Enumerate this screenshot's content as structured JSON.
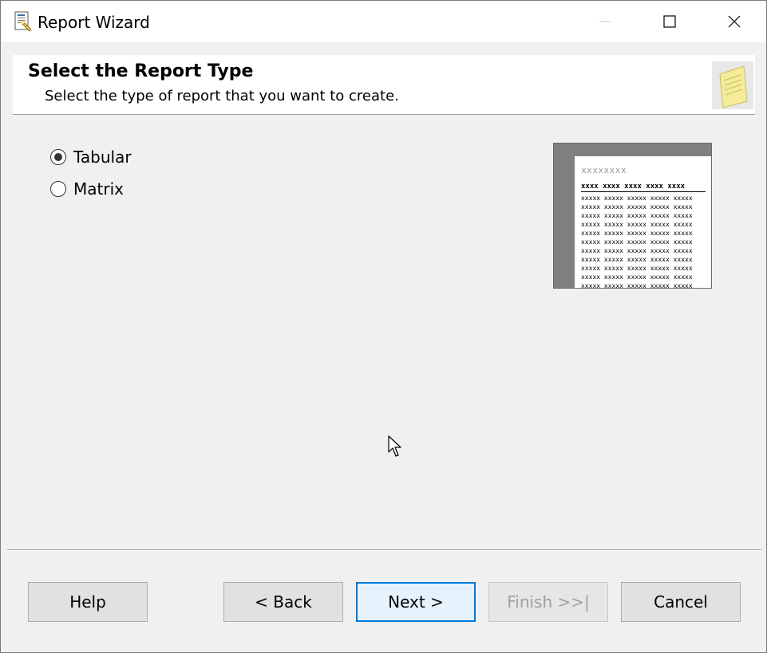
{
  "window": {
    "title": "Report Wizard"
  },
  "header": {
    "title": "Select the Report Type",
    "subtitle": "Select the type of report that you want to create."
  },
  "options": [
    {
      "label": "Tabular",
      "checked": true
    },
    {
      "label": "Matrix",
      "checked": false
    }
  ],
  "preview": {
    "title": "xxxxxxxx",
    "header_row": "xxxx xxxx xxxx xxxx xxxx",
    "data_rows": [
      "xxxxx xxxxx xxxxx xxxxx xxxxx",
      "xxxxx xxxxx xxxxx xxxxx xxxxx",
      "xxxxx xxxxx xxxxx xxxxx xxxxx",
      "xxxxx xxxxx xxxxx xxxxx xxxxx",
      "xxxxx xxxxx xxxxx xxxxx xxxxx",
      "xxxxx xxxxx xxxxx xxxxx xxxxx",
      "xxxxx xxxxx xxxxx xxxxx xxxxx",
      "xxxxx xxxxx xxxxx xxxxx xxxxx",
      "xxxxx xxxxx xxxxx xxxxx xxxxx",
      "xxxxx xxxxx xxxxx xxxxx xxxxx",
      "xxxxx xxxxx xxxxx xxxxx xxxxx"
    ]
  },
  "buttons": {
    "help": "Help",
    "back": "< Back",
    "next": "Next >",
    "finish": "Finish >>|",
    "cancel": "Cancel"
  },
  "colors": {
    "focus_border": "#0078d7",
    "window_bg": "#f0f0f0",
    "disabled_text": "#a0a0a0"
  },
  "icons": {
    "app": "report-wizard-icon",
    "header": "notepad-icon"
  }
}
